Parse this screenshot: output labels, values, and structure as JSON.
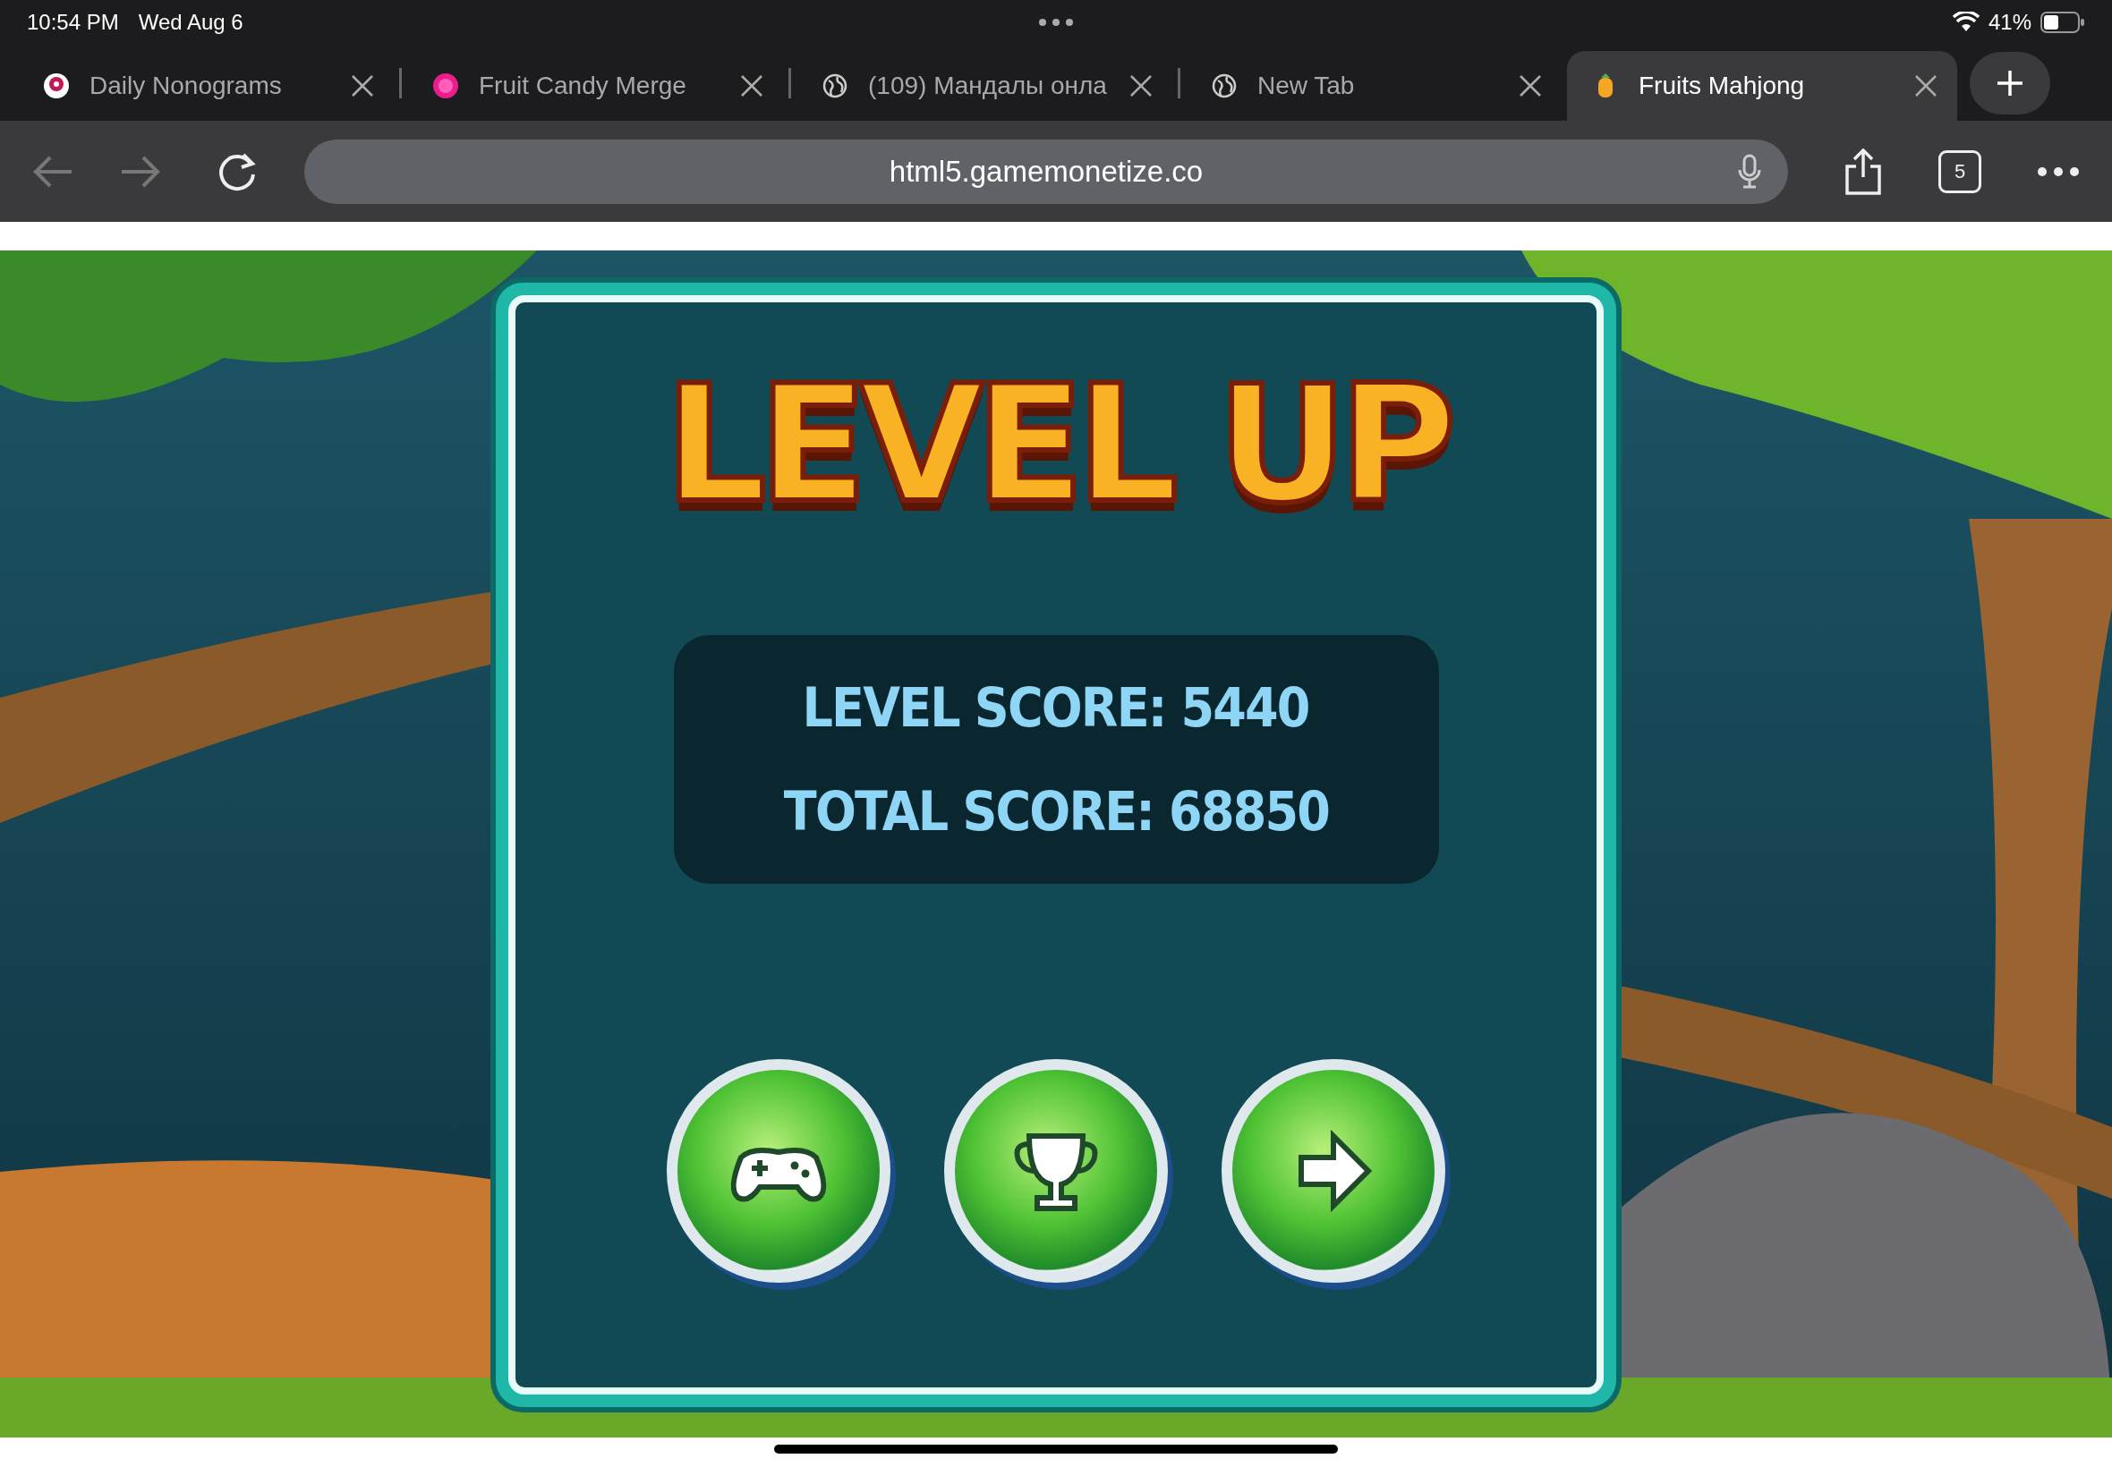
{
  "status_bar": {
    "time": "10:54 PM",
    "date": "Wed Aug 6",
    "battery": "41%"
  },
  "tabs": [
    {
      "title": "Daily Nonograms",
      "kind": "nonogram",
      "selected": false
    },
    {
      "title": "Fruit Candy Merge",
      "kind": "candy",
      "selected": false
    },
    {
      "title": "(109) Мандалы онла",
      "kind": "globe",
      "selected": false
    },
    {
      "title": "New Tab",
      "kind": "globe",
      "selected": false
    },
    {
      "title": "Fruits Mahjong",
      "kind": "fruit",
      "selected": true
    }
  ],
  "toolbar": {
    "url": "html5.gamemonetize.co",
    "tab_count": "5"
  },
  "game": {
    "title": "LEVEL UP",
    "scores": [
      "LEVEL SCORE: 5440",
      "TOTAL SCORE: 68850"
    ],
    "buttons": [
      {
        "kind": "gamepad"
      },
      {
        "kind": "trophy"
      },
      {
        "kind": "next"
      }
    ]
  }
}
